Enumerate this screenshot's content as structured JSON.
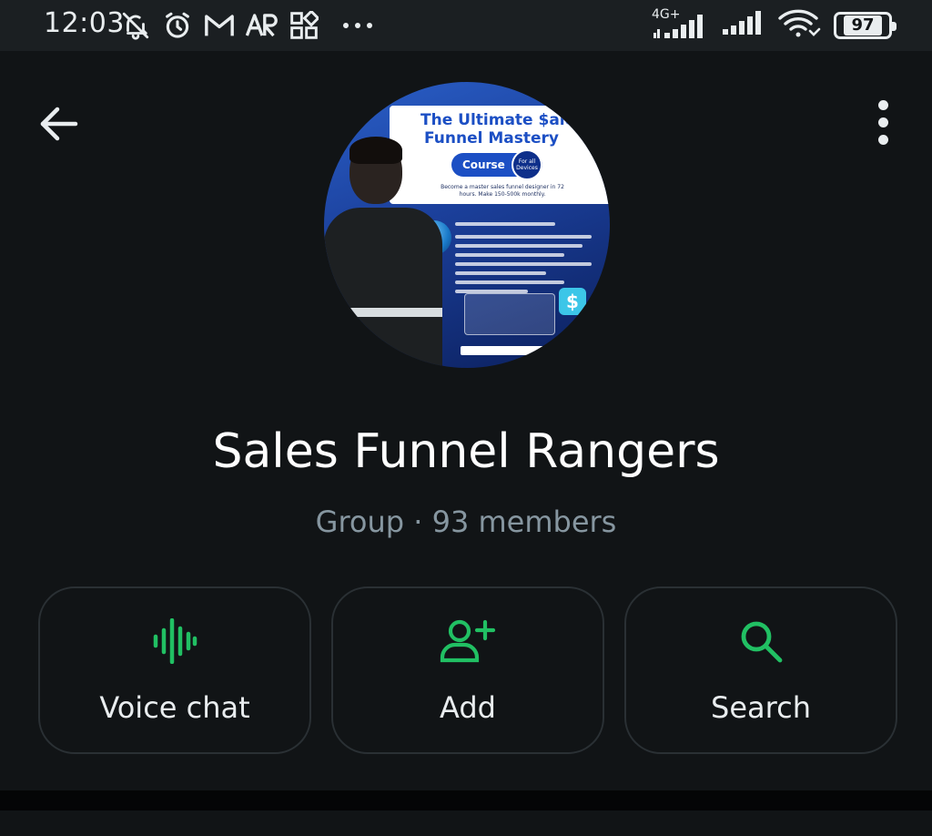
{
  "status_bar": {
    "time": "12:03",
    "network_label": "4G+",
    "battery_level": "97",
    "icons": [
      "bell-off-icon",
      "alarm-icon",
      "gmail-icon",
      "ar-icon",
      "apps-icon",
      "more-dots-icon"
    ]
  },
  "header": {
    "back_icon": "arrow-left-icon",
    "menu_icon": "more-vert-icon"
  },
  "avatar": {
    "title_line1": "The Ultimate $ale",
    "title_line2": "Funnel Mastery",
    "course_label": "Course",
    "badge_text": "For all Devices",
    "subtitle": "Become a master sales funnel designer in 72 hours. Make 150-500k monthly."
  },
  "group": {
    "name": "Sales Funnel Rangers",
    "info": "Group · 93 members"
  },
  "actions": [
    {
      "label": "Voice chat",
      "icon": "voice-chat-icon"
    },
    {
      "label": "Add",
      "icon": "add-person-icon"
    },
    {
      "label": "Search",
      "icon": "search-icon"
    }
  ],
  "colors": {
    "background": "#111416",
    "accent": "#21c063",
    "text_primary": "#ffffff",
    "text_secondary": "#8696a0",
    "button_border": "#2a3034"
  }
}
